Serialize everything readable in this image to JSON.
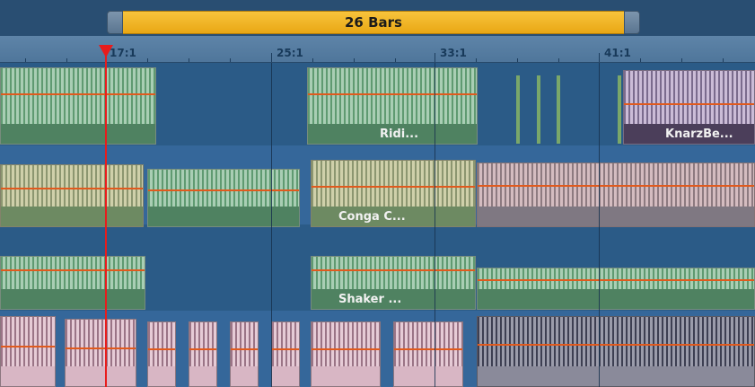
{
  "loop": {
    "label": "26 Bars"
  },
  "ruler": {
    "labels": [
      "17:1",
      "25:1",
      "33:1",
      "41:1"
    ]
  },
  "clips": {
    "ridi_label": "Ridi...",
    "knarz_label": "KnarzBe...",
    "conga_label": "Conga C...",
    "shaker_label": "Shaker ..."
  },
  "colors": {
    "playhead": "#e81c1c",
    "loop_range": "#f0b428",
    "volume_curve": "#e05a1e"
  }
}
